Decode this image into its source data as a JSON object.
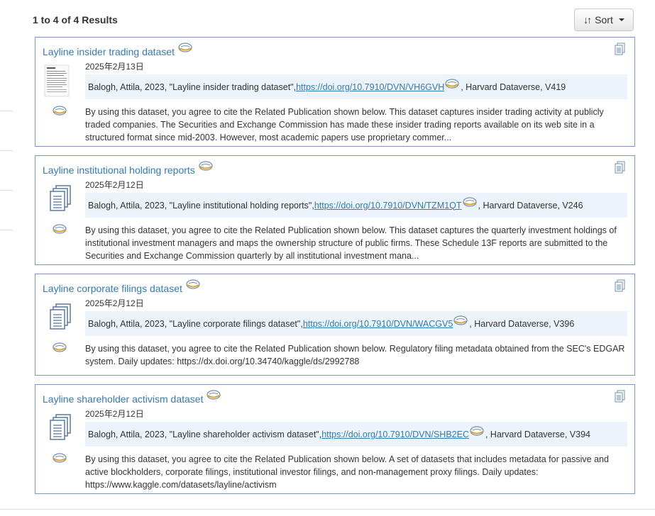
{
  "header": {
    "results_text": "1 to 4 of 4 Results",
    "sort_label": "Sort",
    "sort_icon": "sort-arrows-icon"
  },
  "results": [
    {
      "title": "Layline insider trading dataset",
      "date": "2025年2月13日",
      "citation_prefix": "Balogh, Attila, 2023, \"Layline insider trading dataset\", ",
      "doi_link": "https://doi.org/10.7910/DVN/VH6GVH",
      "citation_suffix": ", Harvard Dataverse, V419",
      "description": "By using this dataset, you agree to cite the Related Publication shown below. This dataset captures insider trading activity at publicly traded companies. The Securities and Exchange Commission has made these insider trading reports available on its web site in a structured format since mid-2003. However, most academic papers use proprietary commer..."
    },
    {
      "title": "Layline institutional holding reports",
      "date": "2025年2月12日",
      "citation_prefix": "Balogh, Attila, 2023, \"Layline institutional holding reports\", ",
      "doi_link": "https://doi.org/10.7910/DVN/TZM1QT",
      "citation_suffix": ", Harvard Dataverse, V246",
      "description": "By using this dataset, you agree to cite the Related Publication shown below. This dataset captures the quarterly investment holdings of institutional investment managers and maps the ownership structure of public firms. These Schedule 13F reports are submitted to the Securities and Exchange Commission quarterly by all institutional investment mana..."
    },
    {
      "title": "Layline corporate filings dataset",
      "date": "2025年2月12日",
      "citation_prefix": "Balogh, Attila, 2023, \"Layline corporate filings dataset\", ",
      "doi_link": "https://doi.org/10.7910/DVN/WACGV5",
      "citation_suffix": ", Harvard Dataverse, V396",
      "description": "By using this dataset, you agree to cite the Related Publication shown below. Regulatory filing metadata obtained from the SEC's EDGAR system. Daily updates: https://dx.doi.org/10.34740/kaggle/ds/2992788"
    },
    {
      "title": "Layline shareholder activism dataset",
      "date": "2025年2月12日",
      "citation_prefix": "Balogh, Attila, 2023, \"Layline shareholder activism dataset\", ",
      "doi_link": "https://doi.org/10.7910/DVN/SHB2EC",
      "citation_suffix": ", Harvard Dataverse, V394",
      "description": "By using this dataset, you agree to cite the Related Publication shown below. A set of datasets that includes metadata for passive and active blockholders, corporate filings, institutional investor filings, and non-management proxy filings. Daily updates: https://www.kaggle.com/datasets/layline/activism"
    }
  ],
  "icons": {
    "dataset_icon": "dataset-copy-icon",
    "badge_icon": "harvard-dataverse-badge-icon",
    "thumbnail": "document-thumbnail",
    "file_stack_icon": "file-stack-icon"
  },
  "colors": {
    "link": "#337ab7",
    "card_border": "#7c99bd",
    "citation_bg": "#edf3fa"
  }
}
